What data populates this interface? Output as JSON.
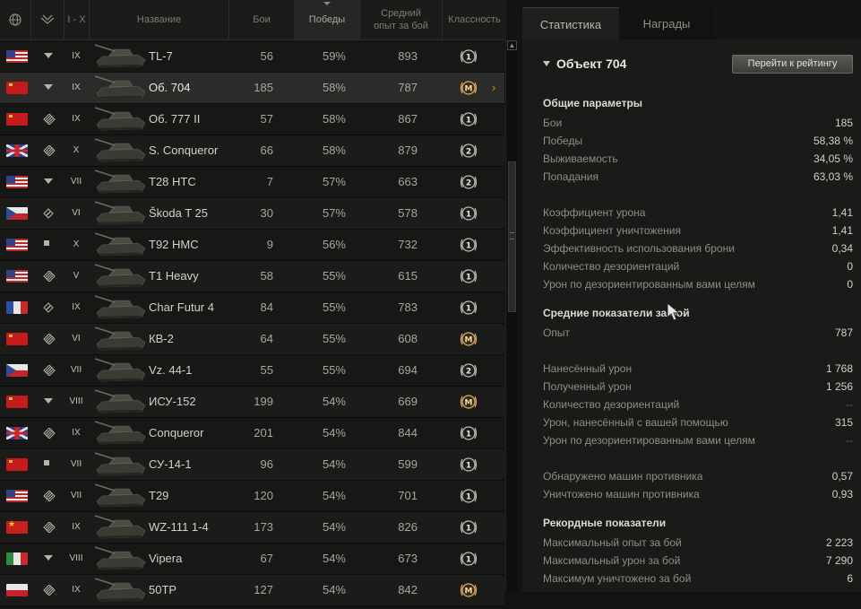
{
  "table": {
    "headers": {
      "tier_range": "I - X",
      "name": "Название",
      "battles": "Бои",
      "wins": "Победы",
      "avg_exp": "Средний опыт за бой",
      "mastery": "Классность"
    },
    "rows": [
      {
        "flag": "usa",
        "type": "td",
        "tier": "IX",
        "name": "TL-7",
        "battles": "56",
        "wins": "59%",
        "exp": "893",
        "mastery": "1",
        "selected": false
      },
      {
        "flag": "ussr",
        "type": "td",
        "tier": "IX",
        "name": "Об. 704",
        "battles": "185",
        "wins": "58%",
        "exp": "787",
        "mastery": "M",
        "selected": true
      },
      {
        "flag": "ussr",
        "type": "heavy",
        "tier": "IX",
        "name": "Об. 777 II",
        "battles": "57",
        "wins": "58%",
        "exp": "867",
        "mastery": "1",
        "selected": false
      },
      {
        "flag": "uk",
        "type": "heavy",
        "tier": "X",
        "name": "S. Conqueror",
        "battles": "66",
        "wins": "58%",
        "exp": "879",
        "mastery": "2",
        "selected": false
      },
      {
        "flag": "usa",
        "type": "td",
        "tier": "VII",
        "name": "T28 HTC",
        "battles": "7",
        "wins": "57%",
        "exp": "663",
        "mastery": "2",
        "selected": false
      },
      {
        "flag": "cz",
        "type": "medium",
        "tier": "VI",
        "name": "Škoda T 25",
        "battles": "30",
        "wins": "57%",
        "exp": "578",
        "mastery": "1",
        "selected": false
      },
      {
        "flag": "usa",
        "type": "spg",
        "tier": "X",
        "name": "T92 HMC",
        "battles": "9",
        "wins": "56%",
        "exp": "732",
        "mastery": "1",
        "selected": false
      },
      {
        "flag": "usa",
        "type": "heavy",
        "tier": "V",
        "name": "T1 Heavy",
        "battles": "58",
        "wins": "55%",
        "exp": "615",
        "mastery": "1",
        "selected": false
      },
      {
        "flag": "fr",
        "type": "medium",
        "tier": "IX",
        "name": "Char Futur 4",
        "battles": "84",
        "wins": "55%",
        "exp": "783",
        "mastery": "1",
        "selected": false
      },
      {
        "flag": "ussr",
        "type": "heavy",
        "tier": "VI",
        "name": "КВ-2",
        "battles": "64",
        "wins": "55%",
        "exp": "608",
        "mastery": "M",
        "selected": false
      },
      {
        "flag": "cz",
        "type": "heavy",
        "tier": "VII",
        "name": "Vz. 44-1",
        "battles": "55",
        "wins": "55%",
        "exp": "694",
        "mastery": "2",
        "selected": false
      },
      {
        "flag": "ussr",
        "type": "td",
        "tier": "VIII",
        "name": "ИСУ-152",
        "battles": "199",
        "wins": "54%",
        "exp": "669",
        "mastery": "M",
        "selected": false
      },
      {
        "flag": "uk",
        "type": "heavy",
        "tier": "IX",
        "name": "Conqueror",
        "battles": "201",
        "wins": "54%",
        "exp": "844",
        "mastery": "1",
        "selected": false
      },
      {
        "flag": "ussr",
        "type": "spg",
        "tier": "VII",
        "name": "СУ-14-1",
        "battles": "96",
        "wins": "54%",
        "exp": "599",
        "mastery": "1",
        "selected": false
      },
      {
        "flag": "usa",
        "type": "heavy",
        "tier": "VII",
        "name": "T29",
        "battles": "120",
        "wins": "54%",
        "exp": "701",
        "mastery": "1",
        "selected": false
      },
      {
        "flag": "cn",
        "type": "heavy",
        "tier": "IX",
        "name": "WZ-111 1-4",
        "battles": "173",
        "wins": "54%",
        "exp": "826",
        "mastery": "1",
        "selected": false
      },
      {
        "flag": "it",
        "type": "td",
        "tier": "VIII",
        "name": "Vipera",
        "battles": "67",
        "wins": "54%",
        "exp": "673",
        "mastery": "1",
        "selected": false
      },
      {
        "flag": "pl",
        "type": "heavy",
        "tier": "IX",
        "name": "50TP",
        "battles": "127",
        "wins": "54%",
        "exp": "842",
        "mastery": "M",
        "selected": false
      }
    ]
  },
  "panel": {
    "tabs": [
      "Статистика",
      "Награды"
    ],
    "vehicle": "Объект 704",
    "rating_button": "Перейти к рейтингу",
    "sections": {
      "general": {
        "title": "Общие параметры",
        "items": [
          {
            "label": "Бои",
            "value": "185"
          },
          {
            "label": "Победы",
            "value": "58,38 %"
          },
          {
            "label": "Выживаемость",
            "value": "34,05 %"
          },
          {
            "label": "Попадания",
            "value": "63,03 %"
          },
          {
            "label": "Коэффициент урона",
            "value": "1,41"
          },
          {
            "label": "Коэффициент уничтожения",
            "value": "1,41"
          },
          {
            "label": "Эффективность использования брони",
            "value": "0,34"
          },
          {
            "label": "Количество дезориентаций",
            "value": "0"
          },
          {
            "label": "Урон по дезориентированным вами целям",
            "value": "0"
          }
        ]
      },
      "average": {
        "title": "Средние показатели за бой",
        "items": [
          {
            "label": "Опыт",
            "value": "787"
          },
          {
            "label": "Нанесённый урон",
            "value": "1 768"
          },
          {
            "label": "Полученный урон",
            "value": "1 256"
          },
          {
            "label": "Количество дезориентаций",
            "value": "--"
          },
          {
            "label": "Урон, нанесённый с вашей помощью",
            "value": "315"
          },
          {
            "label": "Урон по дезориентированным вами целям",
            "value": "--"
          },
          {
            "label": "Обнаружено машин противника",
            "value": "0,57"
          },
          {
            "label": "Уничтожено машин противника",
            "value": "0,93"
          }
        ]
      },
      "records": {
        "title": "Рекордные показатели",
        "items": [
          {
            "label": "Максимальный опыт за бой",
            "value": "2 223"
          },
          {
            "label": "Максимальный урон за бой",
            "value": "7 290"
          },
          {
            "label": "Максимум уничтожено за бой",
            "value": "6"
          }
        ]
      }
    }
  }
}
